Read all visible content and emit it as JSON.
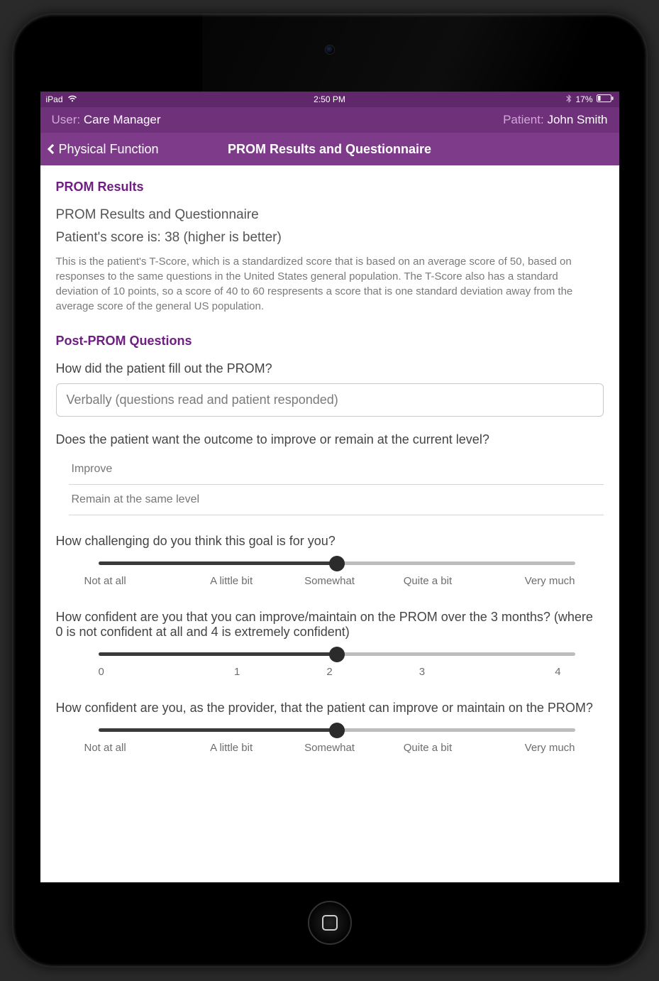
{
  "status": {
    "device": "iPad",
    "time": "2:50 PM",
    "battery_pct": "17%"
  },
  "header": {
    "user_label": "User:",
    "user_value": "Care Manager",
    "patient_label": "Patient:",
    "patient_value": "John Smith"
  },
  "nav": {
    "back_label": "Physical Function",
    "title": "PROM Results and Questionnaire"
  },
  "results": {
    "section_title": "PROM Results",
    "subtitle": "PROM Results and Questionnaire",
    "score_line": "Patient's score is: 38 (higher is better)",
    "explain": "This is the patient's T-Score, which is a standardized score that is based on an average score of 50, based on responses to the same questions in the United States general population. The T-Score also has a standard deviation of 10 points, so a score of 40 to 60 respresents a score that is one standard deviation away from the average score of the general US population."
  },
  "post": {
    "section_title": "Post-PROM Questions",
    "q1": {
      "label": "How did the patient fill out the PROM?",
      "value": "Verbally (questions read and patient responded)"
    },
    "q2": {
      "label": "Does the patient want the outcome to improve or remain at the current level?",
      "options": [
        "Improve",
        "Remain at the same level"
      ]
    },
    "q3": {
      "label": "How challenging do you think this goal is for you?",
      "slider": {
        "ticks": [
          "Not at all",
          "A little bit",
          "Somewhat",
          "Quite a bit",
          "Very much"
        ],
        "value_index": 2
      }
    },
    "q4": {
      "label": "How confident are you that you can improve/maintain on the PROM over the 3 months? (where 0 is not confident at all and 4 is extremely confident)",
      "slider": {
        "ticks": [
          "0",
          "1",
          "2",
          "3",
          "4"
        ],
        "value_index": 2
      }
    },
    "q5": {
      "label": "How confident are you, as the provider, that the patient can improve or maintain on the PROM?",
      "slider": {
        "ticks": [
          "Not at all",
          "A little bit",
          "Somewhat",
          "Quite a bit",
          "Very much"
        ],
        "value_index": 2
      }
    }
  }
}
